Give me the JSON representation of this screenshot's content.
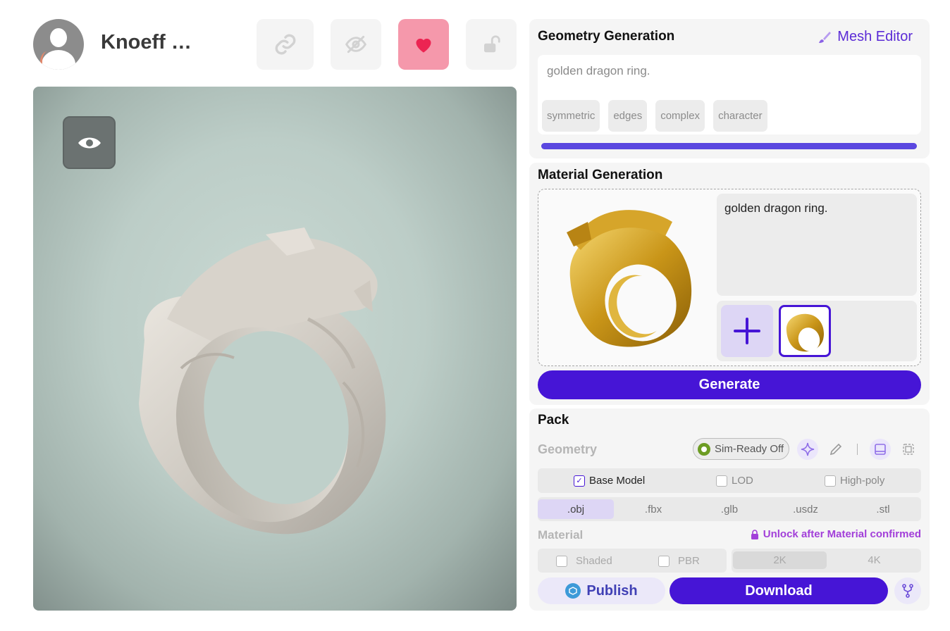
{
  "header": {
    "username": "Knoeff …",
    "icons": [
      "link-icon",
      "eye-slash-icon",
      "heart-icon",
      "unlock-icon"
    ],
    "heart_color": "#f598ab"
  },
  "viewer": {
    "toggle_icon": "eye-icon"
  },
  "geometry": {
    "title": "Geometry Generation",
    "mesh_editor_label": "Mesh Editor",
    "prompt": "golden dragon ring.",
    "tags": [
      "symmetric",
      "edges",
      "complex",
      "character"
    ],
    "progress_percent": 100
  },
  "material": {
    "title": "Material Generation",
    "prompt": "golden dragon ring.",
    "generate_label": "Generate"
  },
  "pack": {
    "title": "Pack",
    "geometry_label": "Geometry",
    "sim_ready_label": "Sim-Ready Off",
    "models": [
      {
        "label": "Base Model",
        "checked": true
      },
      {
        "label": "LOD",
        "checked": false
      },
      {
        "label": "High-poly",
        "checked": false
      }
    ],
    "formats": [
      ".obj",
      ".fbx",
      ".glb",
      ".usdz",
      ".stl"
    ],
    "selected_format": ".obj",
    "material_label": "Material",
    "unlock_note": "Unlock after Material confirmed",
    "material_options": [
      "Shaded",
      "PBR"
    ],
    "resolutions": [
      "2K",
      "4K"
    ],
    "selected_resolution": "2K",
    "publish_label": "Publish",
    "download_label": "Download"
  },
  "colors": {
    "accent": "#4615d6",
    "accent_light": "#ddd6f5",
    "unlock": "#a23fd9"
  }
}
